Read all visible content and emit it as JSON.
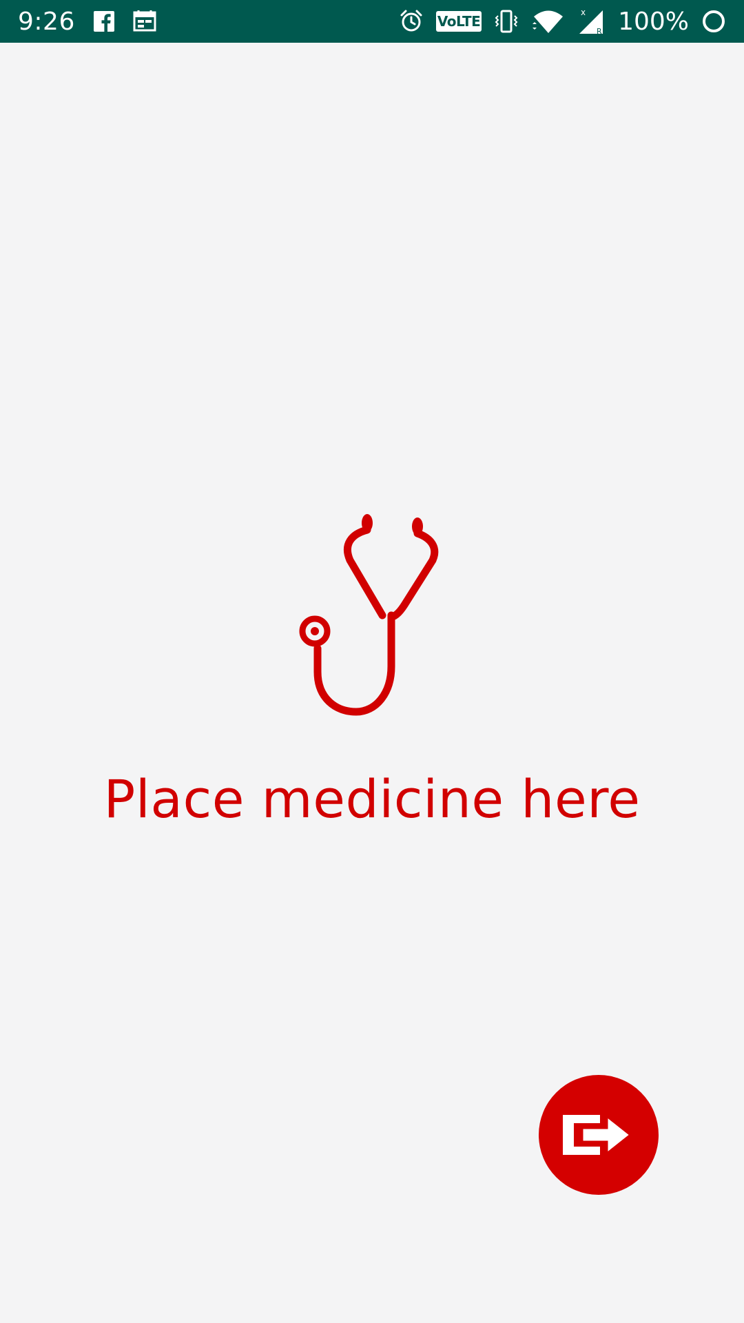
{
  "status_bar": {
    "time": "9:26",
    "volte_label": "VoLTE",
    "battery_text": "100%",
    "background_color": "#00594f",
    "left_icons": [
      "facebook-icon",
      "calendar-notification-icon"
    ],
    "right_icons": [
      "alarm-icon",
      "volte-icon",
      "vibrate-icon",
      "wifi-icon",
      "signal-icon",
      "battery-icon"
    ]
  },
  "main": {
    "illustration_icon": "stethoscope-icon",
    "message": "Place medicine here",
    "accent_color": "#d10000"
  },
  "fab": {
    "icon": "exit-arrow-icon",
    "color": "#d40000"
  }
}
